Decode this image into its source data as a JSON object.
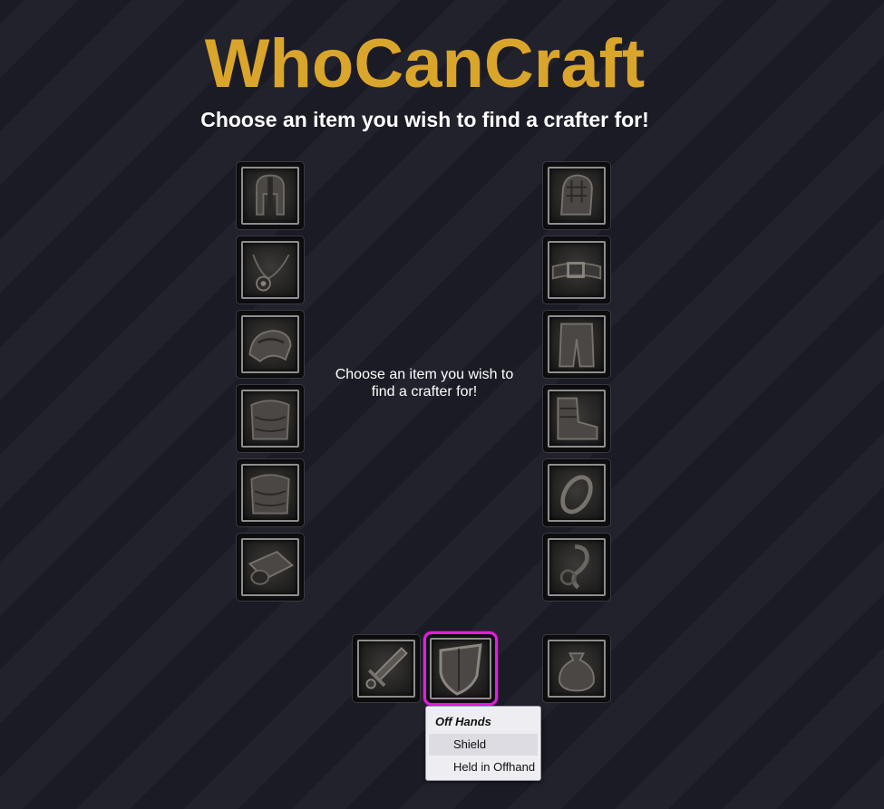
{
  "header": {
    "title": "WhoCanCraft",
    "subtitle": "Choose an item you wish to find a crafter for!"
  },
  "center_message": "Choose an item you wish to find a crafter for!",
  "colors": {
    "title": "#d9a52b",
    "selected_border": "#e21fe0",
    "background": "#1f1f2a"
  },
  "slots": {
    "left": [
      "helmet-icon",
      "amulet-icon",
      "shoulders-icon",
      "cloak-icon",
      "chest-icon",
      "wrist-icon"
    ],
    "right": [
      "gloves-icon",
      "belt-icon",
      "legs-icon",
      "boots-icon",
      "ring-icon",
      "trinket-icon"
    ],
    "bottom": [
      "main-hand-icon",
      "off-hand-icon",
      "bag-icon"
    ]
  },
  "selected_slot": "off-hand-icon",
  "popup": {
    "header": "Off Hands",
    "options": [
      {
        "label": "Shield",
        "highlighted": true
      },
      {
        "label": "Held in Offhand",
        "highlighted": false
      }
    ]
  }
}
